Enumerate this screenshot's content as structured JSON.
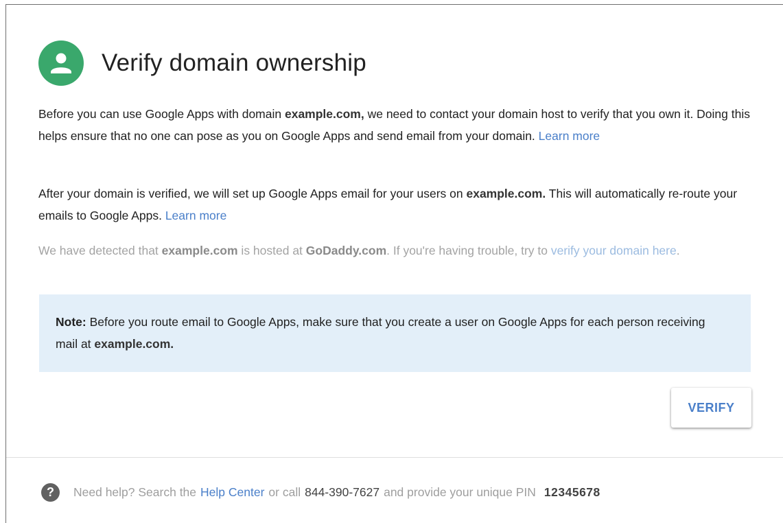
{
  "header": {
    "title": "Verify domain ownership",
    "icon": "person-icon",
    "icon_color": "#3aa86c"
  },
  "paragraph1": {
    "text_before": "Before you can use Google Apps with domain ",
    "domain": "example.com,",
    "text_after": " we need to contact your domain host to verify that you own it. Doing this helps ensure that no one can pose as you on Google Apps and send email from your domain. ",
    "link": "Learn more"
  },
  "paragraph2": {
    "text_before": "After your domain is verified, we will set up Google Apps email for your users on ",
    "domain": "example.com.",
    "text_after": " This will automatically re-route your emails to Google Apps. ",
    "link": "Learn more"
  },
  "paragraph3": {
    "text_before": "We have detected that ",
    "domain": "example.com",
    "text_mid": " is hosted at ",
    "host": "GoDaddy.com",
    "text_after": ". If you're having trouble, try to ",
    "link": "verify your domain here",
    "text_end": "."
  },
  "note": {
    "label": "Note:",
    "text": " Before you route email to Google Apps, make sure that you create a user on Google Apps for each person receiving mail at ",
    "domain": "example.com."
  },
  "verify_button": {
    "label": "VERIFY"
  },
  "footer": {
    "icon": "help-icon",
    "text_before": "Need help? Search the",
    "help_link": "Help Center",
    "text_mid": "or call",
    "phone": "844-390-7627",
    "text_after": "and provide your unique PIN",
    "pin": "12345678"
  },
  "colors": {
    "accent": "#4a7fc9",
    "note_background": "#e3eff9"
  }
}
